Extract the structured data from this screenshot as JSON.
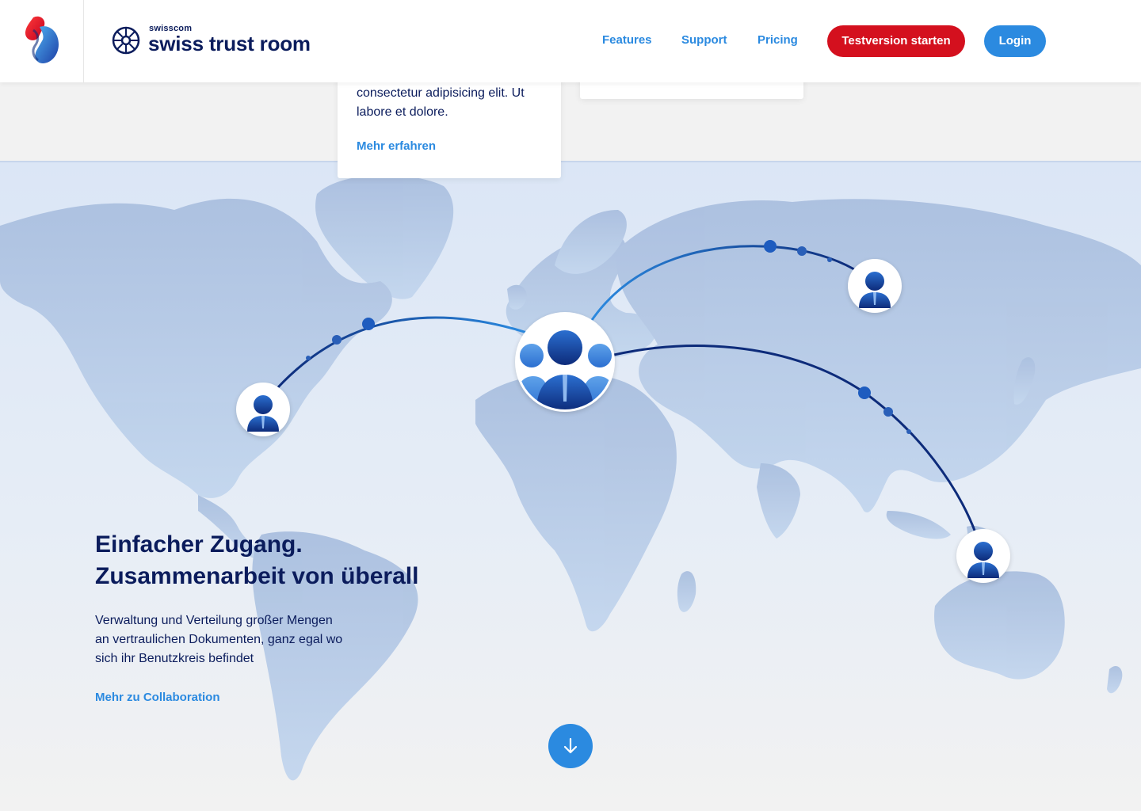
{
  "header": {
    "brand_small": "swisscom",
    "brand_name": "swiss trust room",
    "nav": {
      "features": "Features",
      "support": "Support",
      "pricing": "Pricing"
    },
    "trial_button": "Testversion starten",
    "login_button": "Login"
  },
  "cards": {
    "left_text": "consectetur adipisicing elit. Ut labore et dolore.",
    "left_link": "Mehr erfahren"
  },
  "collaboration": {
    "headline_line1": "Einfacher Zugang.",
    "headline_line2": "Zusammenarbeit von überall",
    "body": "Verwaltung und Verteilung großer Mengen an vertraulichen Dokumenten, ganz egal wo sich ihr Benutzkreis befindet",
    "link": "Mehr zu Collaboration"
  },
  "icons": {
    "swisscom_logo": "swisscom-logo-icon",
    "brand_logo": "trust-room-logo-icon",
    "scroll_down": "arrow-down-icon",
    "user": "user-avatar-icon",
    "group": "user-group-icon"
  },
  "colors": {
    "primary_blue": "#2b8ae0",
    "navy": "#0b1c5c",
    "swisscom_red": "#d4101e",
    "map_land": "#b3c6e1",
    "map_bg": "#dbe6f6"
  }
}
